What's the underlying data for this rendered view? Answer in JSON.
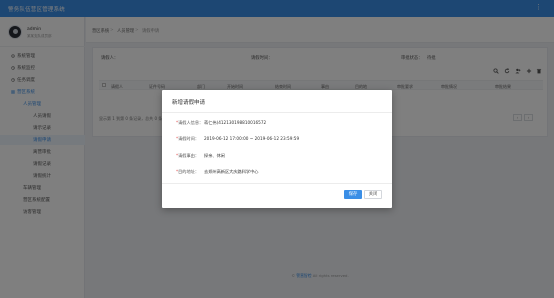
{
  "app": {
    "title": "警务队伍营区管理系统",
    "more_icon": "vertical-ellipsis-icon"
  },
  "user": {
    "name": "admin",
    "subtitle": "某某支队成员部"
  },
  "sidebar": {
    "items": [
      {
        "label": "系统管理",
        "icon": "gear-icon",
        "level": 0
      },
      {
        "label": "系统监控",
        "icon": "monitor-icon",
        "level": 0
      },
      {
        "label": "任务调度",
        "icon": "clock-icon",
        "level": 0
      },
      {
        "label": "营区系统",
        "icon": "grid-icon",
        "level": 0,
        "state": "active"
      },
      {
        "label": "人员管理",
        "level": 1,
        "state": "active"
      },
      {
        "label": "人员请假",
        "level": 2
      },
      {
        "label": "请示记录",
        "level": 2
      },
      {
        "label": "请假申请",
        "level": 2,
        "state": "selected"
      },
      {
        "label": "离营审批",
        "level": 2
      },
      {
        "label": "请假记录",
        "level": 2
      },
      {
        "label": "请假统计",
        "level": 2
      },
      {
        "label": "车辆管理",
        "level": 1
      },
      {
        "label": "营区系统配置",
        "level": 1
      },
      {
        "label": "访客管理",
        "level": 1
      }
    ]
  },
  "breadcrumb": [
    "营区系统",
    "人员管理",
    "请假申请"
  ],
  "filters": {
    "applicant": "请假人：",
    "time": "请假时间：",
    "status": "审批状态：",
    "status_value": "待批"
  },
  "table": {
    "columns": [
      "请假人",
      "证件号码",
      "部门",
      "开始时间",
      "结束时间",
      "事由",
      "目的地",
      "审批要求",
      "审批情况",
      "审批结果"
    ]
  },
  "pagination": {
    "info": "显示第 1 到第 0 条记录，总共 0 条记录",
    "prev": "‹",
    "next": "›"
  },
  "footer": {
    "prefix": "© ",
    "brand": "警营智检",
    " suffix": "",
    "rights": " All rights reserved."
  },
  "dialog": {
    "title": "新增请假申请",
    "fields": [
      {
        "label": "请假人信息：",
        "value": "蒋仁伟(412130198810016572"
      },
      {
        "label": "请假时间：",
        "value": "2019-06-12 17:00:00 ~ 2019-06-12 23:59:59"
      },
      {
        "label": "请假事由：",
        "value": "探亲、休闲"
      },
      {
        "label": "目的地址：",
        "value": "去郑州高新区大庆路科学中心"
      }
    ],
    "save_label": "保存",
    "close_label": "关闭"
  }
}
